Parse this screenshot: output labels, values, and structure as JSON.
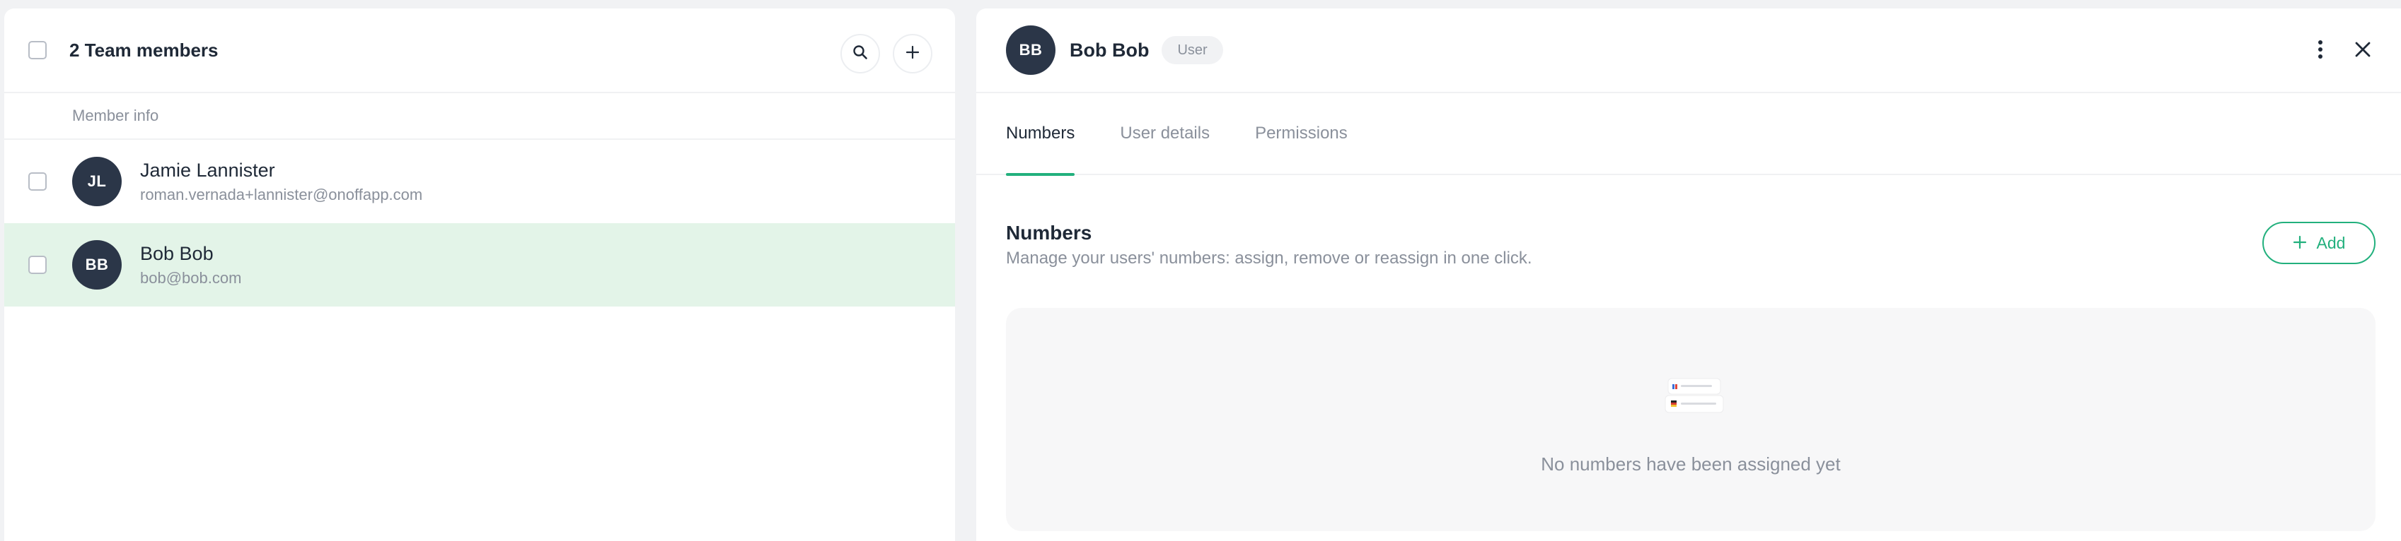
{
  "team": {
    "title": "2 Team members",
    "column_header": "Member info",
    "members": [
      {
        "initials": "JL",
        "name": "Jamie Lannister",
        "email": "roman.vernada+lannister@onoffapp.com",
        "selected": false
      },
      {
        "initials": "BB",
        "name": "Bob Bob",
        "email": "bob@bob.com",
        "selected": true
      }
    ]
  },
  "detail": {
    "initials": "BB",
    "name": "Bob Bob",
    "role": "User",
    "tabs": [
      {
        "label": "Numbers",
        "active": true
      },
      {
        "label": "User details",
        "active": false
      },
      {
        "label": "Permissions",
        "active": false
      }
    ],
    "section": {
      "title": "Numbers",
      "description": "Manage your users' numbers: assign, remove or reassign in one click.",
      "add_label": "Add",
      "empty_text": "No numbers have been assigned yet"
    }
  },
  "icons": {
    "search": "search-icon",
    "add": "plus-icon",
    "more": "more-vertical-icon",
    "close": "close-icon"
  },
  "colors": {
    "accent": "#22b07d",
    "avatar_bg": "#2b3648",
    "selected_row": "#e3f4e8"
  }
}
